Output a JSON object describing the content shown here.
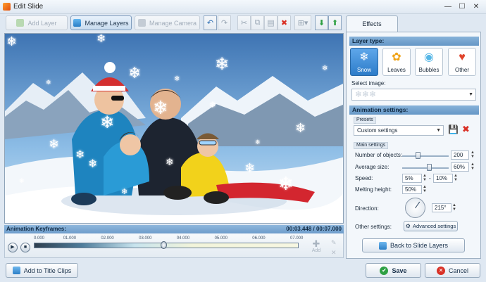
{
  "window": {
    "title": "Edit Slide",
    "min_glyph": "—",
    "max_glyph": "☐",
    "close_glyph": "✕"
  },
  "toolbar": {
    "add_layer": "Add Layer",
    "manage_layers": "Manage Layers",
    "manage_camera": "Manage Camera"
  },
  "keyframes": {
    "title": "Animation Keyframes:",
    "current_time": "00:03.448 / 00:07.000",
    "ticks": [
      "0.000",
      "01.000",
      "02.000",
      "03.000",
      "04.000",
      "05.000",
      "06.000",
      "07.000"
    ],
    "playhead_fraction": 0.49,
    "add_label": "Add"
  },
  "bottom": {
    "add_to_title_clips": "Add to Title Clips",
    "save": "Save",
    "cancel": "Cancel"
  },
  "effects_panel": {
    "tab_label": "Effects",
    "layer_type_heading": "Layer type:",
    "layer_types": [
      {
        "label": "Snow",
        "selected": true
      },
      {
        "label": "Leaves",
        "selected": false
      },
      {
        "label": "Bubbles",
        "selected": false
      },
      {
        "label": "Other",
        "selected": false
      }
    ],
    "select_image_label": "Select image:",
    "animation_heading": "Animation settings:",
    "presets_label": "Presets",
    "preset_value": "Custom settings",
    "main_settings_label": "Main settings",
    "number_of_objects_label": "Number of objects:",
    "number_of_objects_value": "200",
    "average_size_label": "Average size:",
    "average_size_value": "60%",
    "speed_label": "Speed:",
    "speed_min": "5%",
    "speed_max": "10%",
    "speed_sep": "-",
    "melting_height_label": "Melting height:",
    "melting_height_value": "50%",
    "direction_label": "Direction:",
    "direction_value": "215°",
    "other_settings_label": "Other settings:",
    "advanced_settings": "Advanced settings",
    "back_to_layers": "Back to Slide Layers"
  },
  "colors": {
    "accent": "#2d7cc9",
    "save_green": "#2ea043",
    "cancel_red": "#d93025"
  }
}
